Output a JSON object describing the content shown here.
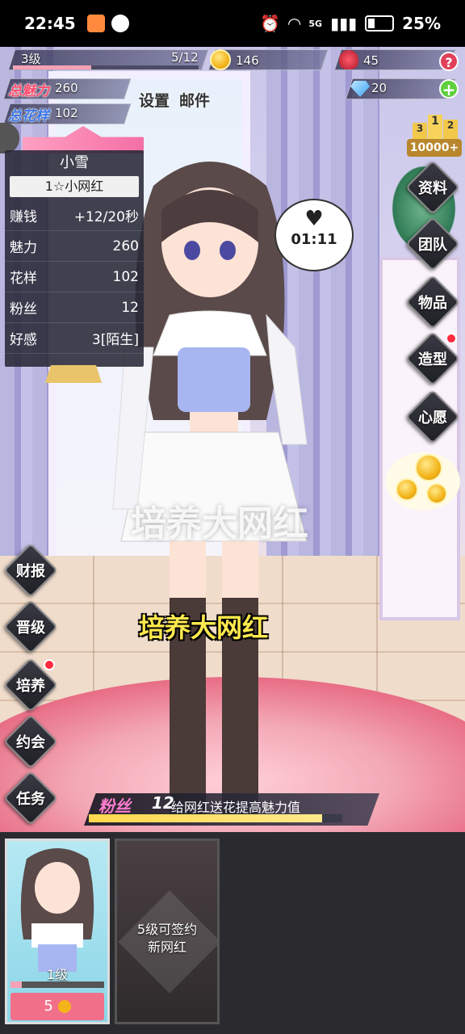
{
  "status_bar": {
    "time": "22:45",
    "network": "5G",
    "battery": "25%"
  },
  "player": {
    "level": "3级",
    "exp": "5/12",
    "exp_fraction": 0.42
  },
  "resources": {
    "coins": "146",
    "roses": "45",
    "diamonds": "20",
    "help_glyph": "?",
    "add_glyph": "+"
  },
  "totals": {
    "charm_label": "总魅力",
    "charm_value": "260",
    "pattern_label": "总花样",
    "pattern_value": "102"
  },
  "top_links": {
    "settings": "设置",
    "mail": "邮件"
  },
  "ranking": {
    "podium": [
      "3",
      "1",
      "2"
    ],
    "badge": "10000+"
  },
  "character": {
    "name": "小雪",
    "title": "1☆小网红",
    "stats": [
      {
        "label": "赚钱",
        "value": "+12/20秒"
      },
      {
        "label": "魅力",
        "value": "260"
      },
      {
        "label": "花样",
        "value": "102"
      },
      {
        "label": "粉丝",
        "value": "12"
      },
      {
        "label": "好感",
        "value": "3[陌生]"
      }
    ],
    "timer": "01:11"
  },
  "right_menu": [
    {
      "label": "资料",
      "badge": false
    },
    {
      "label": "团队",
      "badge": false
    },
    {
      "label": "物品",
      "badge": false
    },
    {
      "label": "造型",
      "badge": true
    },
    {
      "label": "心愿",
      "badge": false
    }
  ],
  "left_menu": [
    {
      "label": "财报",
      "badge": false
    },
    {
      "label": "晋级",
      "badge": false
    },
    {
      "label": "培养",
      "badge": true
    },
    {
      "label": "约会",
      "badge": false
    },
    {
      "label": "任务",
      "badge": false
    }
  ],
  "overlays": {
    "big_caption": "培养大网红",
    "subtitle": "培养大网红"
  },
  "fans_bar": {
    "label": "粉丝",
    "value": "12",
    "tip": "给网红送花提高魅力值",
    "fill_fraction": 0.92
  },
  "cards": [
    {
      "level": "1级",
      "cost": "5",
      "progress": 0.12
    },
    {
      "locked_text_1": "5级可签约",
      "locked_text_2": "新网红"
    }
  ],
  "colors": {
    "accent_pink": "#f6a1b5",
    "coin_gold": "#f3b41a",
    "badge_red": "#ff2a3d",
    "subtitle_yellow": "#ffe94d"
  }
}
